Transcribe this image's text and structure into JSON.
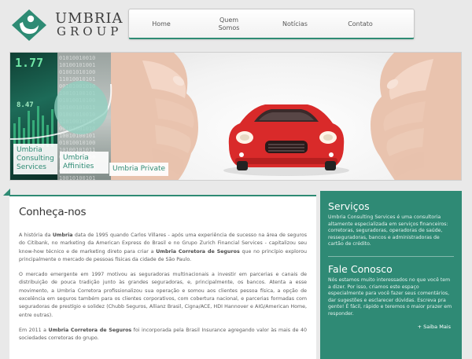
{
  "brand": {
    "line1": "UMBRIA",
    "line2": "GROUP"
  },
  "nav": [
    {
      "label": "Home"
    },
    {
      "label": "Quem Somos"
    },
    {
      "label": "Notícias"
    },
    {
      "label": "Contato"
    }
  ],
  "banner": {
    "stock_numbers": [
      "1.77",
      "8.47"
    ],
    "binary_text": "01010010010\n10100101001\n01001010100\n11010010101\n00101001010\n10010100101\n01010010100\n10100101011\n01001010010\n11010010101\n00101001010\n10010100101\n01010010100\n10100101011\n01001010010\n11010010101\n00101001010\n10010100101",
    "labels": {
      "consulting": "Umbria Consulting Services",
      "affinities": "Umbria Affinities",
      "private": "Umbria Private"
    }
  },
  "main": {
    "title": "Conheça-nos",
    "p1_a": "A história da ",
    "p1_b": "Umbria",
    "p1_c": " data de 1995 quando Carlos Villares - após uma experiência de sucesso na área de seguros do Citibank, no marketing da American Express do Brasil e no Grupo Zurich Financial Services - capitalizou seu know-how técnico e de marketing direto para criar a ",
    "p1_d": "Umbria Corretora de Seguros",
    "p1_e": " que no princípio explorou principalmente o mercado de pessoas físicas da cidade de São Paulo.",
    "p2": "O mercado emergente em 1997 motivou as seguradoras multinacionais a investir em parcerias e canais de distribuição de pouca tradição junto às grandes seguradoras, e, principalmente, os bancos. Atenta a esse movimento, a Umbria Corretora profissionalizou sua operação e somou aos clientes pessoa física, a opção de excelência em seguros também para os clientes corporativos, com cobertura nacional, e parcerias formadas com seguradoras de prestígio e solidez (Chubb Seguros, Allianz Brasil, Cigna/ACE, HDI Hannover e AIG/American Home, entre outras).",
    "p3_a": "Em 2011 a ",
    "p3_b": "Umbria Corretora de Seguros",
    "p3_c": " foi incorporada pela Brasil Insurance agregando valor às mais de 40 sociedades corretoras do grupo."
  },
  "side": {
    "servicos_title": "Serviços",
    "servicos_text": "Umbria Consulting Services é uma consultoria altamente especializada em serviços financeiros: corretoras, seguradoras, operadoras de saúde, resseguradoras, bancos e administradoras de cartão de crédito.",
    "fale_title": "Fale Conosco",
    "fale_text": "Nós estamos muito interessados no que você tem a dizer. Por isso, criamos este espaço especialmente para você fazer seus comentários, dar sugestões e esclarecer dúvidas. Escreva pra gente! É fácil, rápido e teremos o maior prazer em responder.",
    "saiba_mais": "+ Saiba Mais"
  },
  "colors": {
    "brand_green": "#2e8b74",
    "car_red": "#d92a2a"
  },
  "icons": [
    "umbria-logo-icon"
  ]
}
